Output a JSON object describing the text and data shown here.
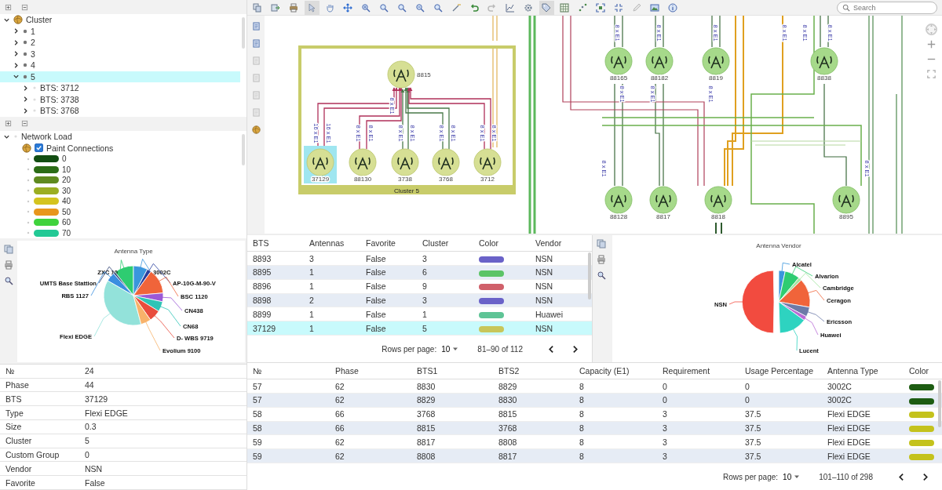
{
  "cluster_tree": {
    "label": "Cluster",
    "expanded": true,
    "children": [
      {
        "label": "1",
        "expanded": false,
        "selected": false
      },
      {
        "label": "2",
        "expanded": false,
        "selected": false
      },
      {
        "label": "3",
        "expanded": false,
        "selected": false
      },
      {
        "label": "4",
        "expanded": false,
        "selected": false
      },
      {
        "label": "5",
        "expanded": true,
        "selected": true,
        "children": [
          {
            "label": "BTS: 3712",
            "expanded": false,
            "selected": false
          },
          {
            "label": "BTS: 3738",
            "expanded": false,
            "selected": false
          },
          {
            "label": "BTS: 3768",
            "expanded": false,
            "selected": false
          }
        ]
      }
    ]
  },
  "network_load": {
    "label": "Network Load",
    "expanded": true,
    "paint_connections": {
      "label": "Paint Connections",
      "checked": true
    },
    "levels": [
      {
        "label": "0",
        "color": "#124d12"
      },
      {
        "label": "10",
        "color": "#2b6c16"
      },
      {
        "label": "20",
        "color": "#5f8a1f"
      },
      {
        "label": "30",
        "color": "#9bae22"
      },
      {
        "label": "40",
        "color": "#d4c41f"
      },
      {
        "label": "50",
        "color": "#e8961c"
      },
      {
        "label": "60",
        "color": "#3fd33c"
      },
      {
        "label": "70",
        "color": "#22c995"
      }
    ]
  },
  "antenna_type_chart": {
    "title": "Antenna Type",
    "labels": [
      "ZXC 10",
      "3002C",
      "UMTS Base Stattion",
      "AP-10G-M-90-V",
      "RBS 1127",
      "BSC 1120",
      "CN438",
      "CN68",
      "Flexi EDGE",
      "D- WBS 9719",
      "Evolium 9100"
    ]
  },
  "properties": [
    {
      "name": "№",
      "value": "24"
    },
    {
      "name": "Phase",
      "value": "44"
    },
    {
      "name": "BTS",
      "value": "37129"
    },
    {
      "name": "Type",
      "value": "Flexi EDGE"
    },
    {
      "name": "Size",
      "value": "0.3"
    },
    {
      "name": "Cluster",
      "value": "5"
    },
    {
      "name": "Custom Group",
      "value": "0"
    },
    {
      "name": "Vendor",
      "value": "NSN"
    },
    {
      "name": "Favorite",
      "value": "False"
    }
  ],
  "toolbar": {
    "tools": [
      {
        "kind": "copy",
        "selected": false
      },
      {
        "kind": "export",
        "selected": false
      },
      {
        "kind": "print",
        "selected": false
      },
      {
        "kind": "cursor",
        "selected": true
      },
      {
        "kind": "hand",
        "selected": false
      },
      {
        "kind": "move",
        "selected": false
      },
      {
        "kind": "zoom-in",
        "selected": false
      },
      {
        "kind": "magnifier",
        "selected": false
      },
      {
        "kind": "magnifier",
        "selected": false
      },
      {
        "kind": "zoom-out",
        "selected": false
      },
      {
        "kind": "magnifier",
        "selected": false
      },
      {
        "kind": "wand",
        "selected": false
      },
      {
        "kind": "undo",
        "selected": false
      },
      {
        "kind": "redo",
        "selected": false
      },
      {
        "kind": "chart",
        "selected": false
      },
      {
        "kind": "gear",
        "selected": false
      },
      {
        "kind": "tag",
        "selected": true
      },
      {
        "kind": "grid",
        "selected": false
      },
      {
        "kind": "scatter",
        "selected": false
      },
      {
        "kind": "expand",
        "selected": false
      },
      {
        "kind": "shrink",
        "selected": false
      },
      {
        "kind": "pen",
        "selected": false
      },
      {
        "kind": "image",
        "selected": false
      },
      {
        "kind": "info",
        "selected": false
      }
    ],
    "search": {
      "placeholder": "Search"
    }
  },
  "diagram": {
    "cluster": {
      "label": "Cluster 5"
    },
    "nodes": [
      {
        "label": "8815",
        "selected": false
      },
      {
        "label": "37129",
        "selected": true
      },
      {
        "label": "88130",
        "selected": false
      },
      {
        "label": "3738",
        "selected": false
      },
      {
        "label": "3768",
        "selected": false
      },
      {
        "label": "3712",
        "selected": false
      },
      {
        "label": "88165",
        "selected": false
      },
      {
        "label": "88182",
        "selected": false
      },
      {
        "label": "8819",
        "selected": false
      },
      {
        "label": "8838",
        "selected": false
      },
      {
        "label": "88128",
        "selected": false
      },
      {
        "label": "8817",
        "selected": false
      },
      {
        "label": "8818",
        "selected": false
      },
      {
        "label": "8895",
        "selected": false
      }
    ],
    "edge_labels": [
      "16 x E1",
      "16 x E1",
      "8 x E1",
      "8 x E1",
      "8 x E1",
      "8 x E1",
      "8 x E1",
      "8 x E1",
      "8 x E1",
      "8 x E1",
      "8 x E1",
      "8 x E1",
      "8 x E1",
      "8 x E1",
      "8 x E1",
      "8 x E1",
      "8 x E1",
      "8 x E1",
      "8 x E1",
      "8 x E1",
      "8 x E1",
      "8 x E1"
    ]
  },
  "bts_table": {
    "columns": [
      "BTS",
      "Antennas",
      "Favorite",
      "Cluster",
      "Color",
      "Vendor"
    ],
    "rows": [
      {
        "cells": [
          "8893",
          "3",
          "False",
          "3"
        ],
        "color": "#6a62c8",
        "vendor": "NSN",
        "selected": false
      },
      {
        "cells": [
          "8895",
          "1",
          "False",
          "6"
        ],
        "color": "#5cc466",
        "vendor": "NSN",
        "selected": false
      },
      {
        "cells": [
          "8896",
          "1",
          "False",
          "9"
        ],
        "color": "#d0606a",
        "vendor": "NSN",
        "selected": false
      },
      {
        "cells": [
          "8898",
          "2",
          "False",
          "3"
        ],
        "color": "#6a62c8",
        "vendor": "NSN",
        "selected": false
      },
      {
        "cells": [
          "8899",
          "1",
          "False",
          "1"
        ],
        "color": "#5ec496",
        "vendor": "Huawei",
        "selected": false
      },
      {
        "cells": [
          "37129",
          "1",
          "False",
          "5"
        ],
        "color": "#c8c65a",
        "vendor": "NSN",
        "selected": true
      }
    ],
    "pagination": {
      "label": "Rows per page:",
      "rows_per_page": "10",
      "range": "81–90 of 112"
    }
  },
  "vendor_chart": {
    "title": "Antenna Vendor",
    "labels": [
      "Alcatel",
      "Alvarion",
      "Cambridge",
      "Ceragon",
      "NSN",
      "Ericsson",
      "Huawei",
      "Lucent"
    ]
  },
  "links_table": {
    "columns": [
      "№",
      "Phase",
      "BTS1",
      "BTS2",
      "Capacity (E1)",
      "Requirement",
      "Usage Percentage",
      "Antenna Type",
      "Color"
    ],
    "rows": [
      {
        "cells": [
          "57",
          "62",
          "8830",
          "8829",
          "8",
          "0",
          "0",
          "3002C"
        ],
        "color": "#1d5c12"
      },
      {
        "cells": [
          "57",
          "62",
          "8829",
          "8830",
          "8",
          "0",
          "0",
          "3002C"
        ],
        "color": "#1d5c12"
      },
      {
        "cells": [
          "58",
          "66",
          "3768",
          "8815",
          "8",
          "3",
          "37.5",
          "Flexi EDGE"
        ],
        "color": "#c4c21c"
      },
      {
        "cells": [
          "58",
          "66",
          "8815",
          "3768",
          "8",
          "3",
          "37.5",
          "Flexi EDGE"
        ],
        "color": "#c4c21c"
      },
      {
        "cells": [
          "59",
          "62",
          "8817",
          "8808",
          "8",
          "3",
          "37.5",
          "Flexi EDGE"
        ],
        "color": "#c4c21c"
      },
      {
        "cells": [
          "59",
          "62",
          "8808",
          "8817",
          "8",
          "3",
          "37.5",
          "Flexi EDGE"
        ],
        "color": "#c4c21c"
      }
    ],
    "pagination": {
      "label": "Rows per page:",
      "rows_per_page": "10",
      "range": "101–110 of 298"
    }
  }
}
